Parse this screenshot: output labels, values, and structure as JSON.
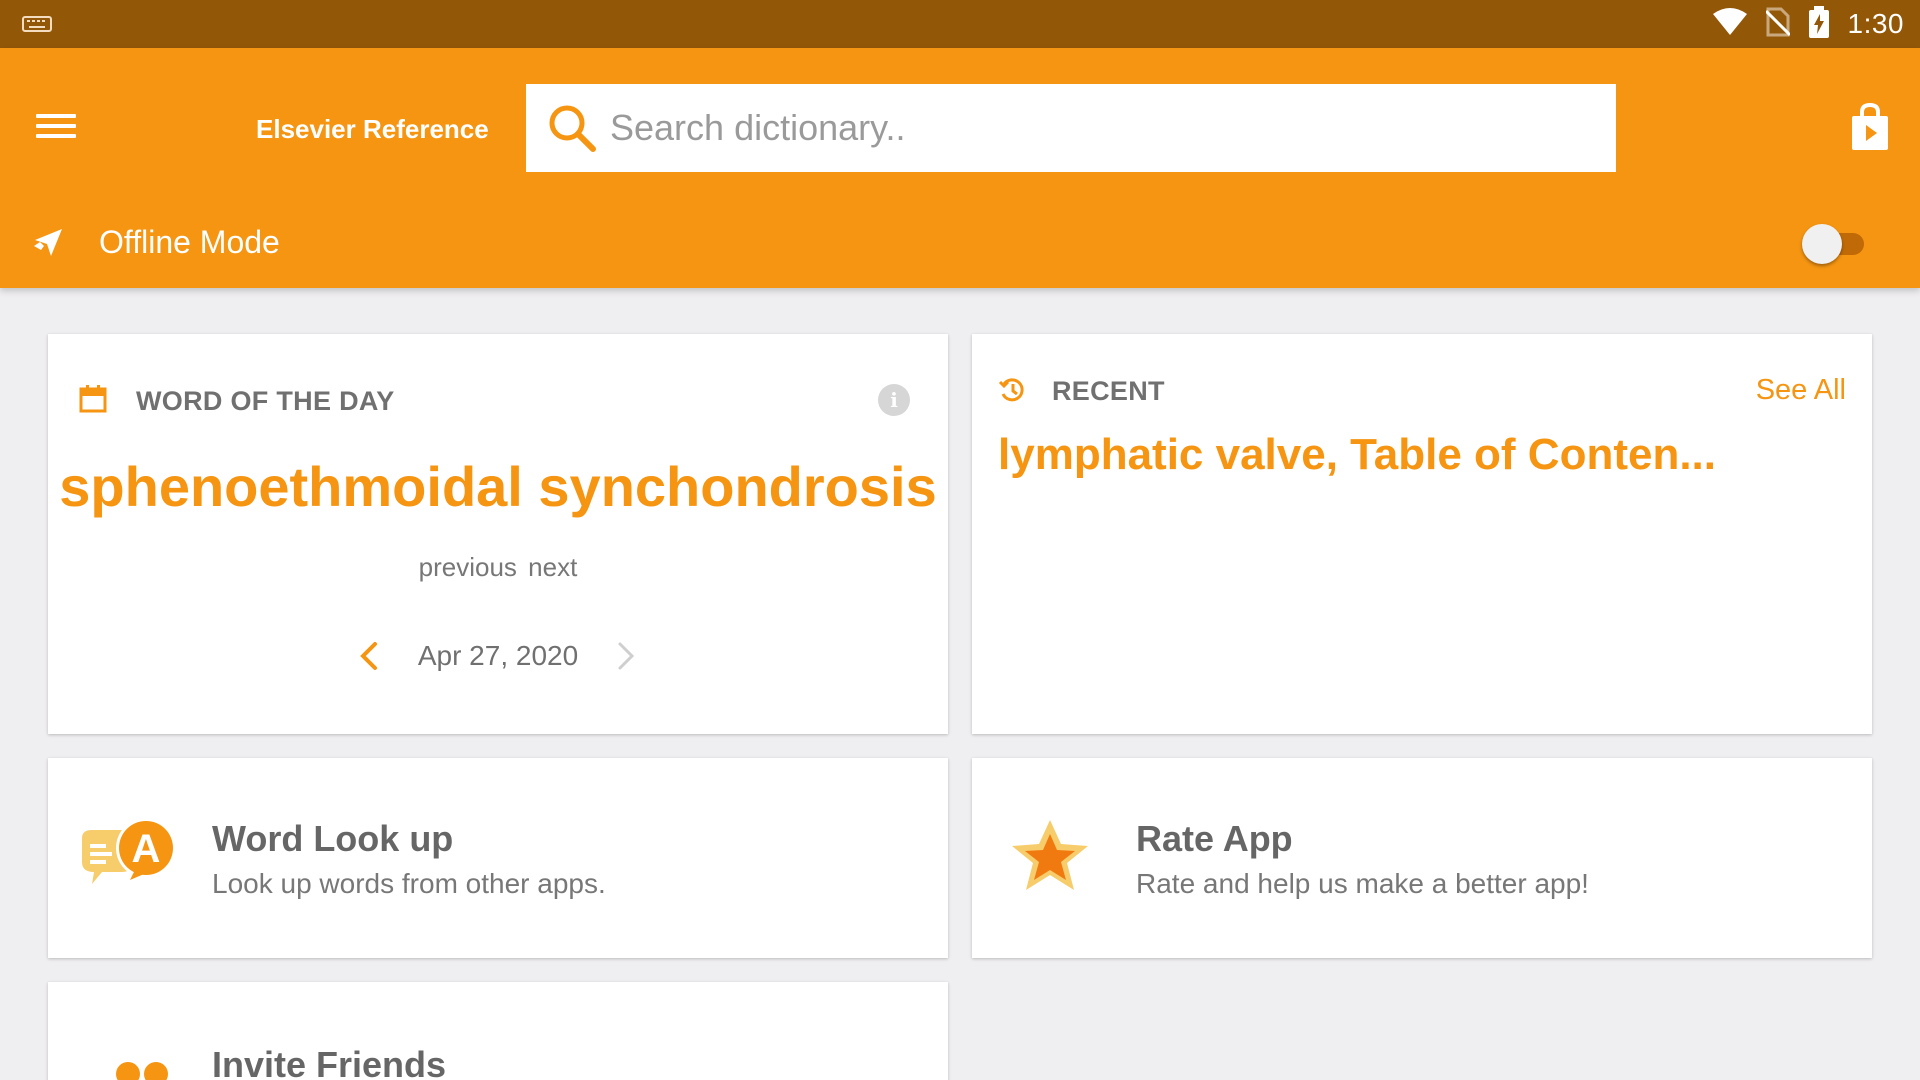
{
  "status_bar": {
    "time": "1:30",
    "icons": [
      "keyboard-icon",
      "wifi-icon",
      "no-sim-icon",
      "battery-charging-icon"
    ]
  },
  "app_bar": {
    "title": "Elsevier Reference",
    "search": {
      "placeholder": "Search dictionary..",
      "value": ""
    },
    "offline_mode": {
      "label": "Offline Mode",
      "enabled": false
    }
  },
  "word_of_the_day": {
    "header": "WORD OF THE DAY",
    "word": "sphenoethmoidal synchondrosis",
    "previous_label": "previous",
    "next_label": "next",
    "date": "Apr 27, 2020"
  },
  "recent": {
    "header": "RECENT",
    "see_all": "See All",
    "items_text": "lymphatic valve, Table of Conten..."
  },
  "features": {
    "lookup": {
      "title": "Word Look up",
      "description": "Look up words from other apps."
    },
    "rate": {
      "title": "Rate App",
      "description": "Rate and help us make a better app!"
    },
    "invite": {
      "title": "Invite Friends"
    }
  },
  "colors": {
    "accent": "#f59512",
    "status_bar": "#935708",
    "background": "#efeef0"
  }
}
